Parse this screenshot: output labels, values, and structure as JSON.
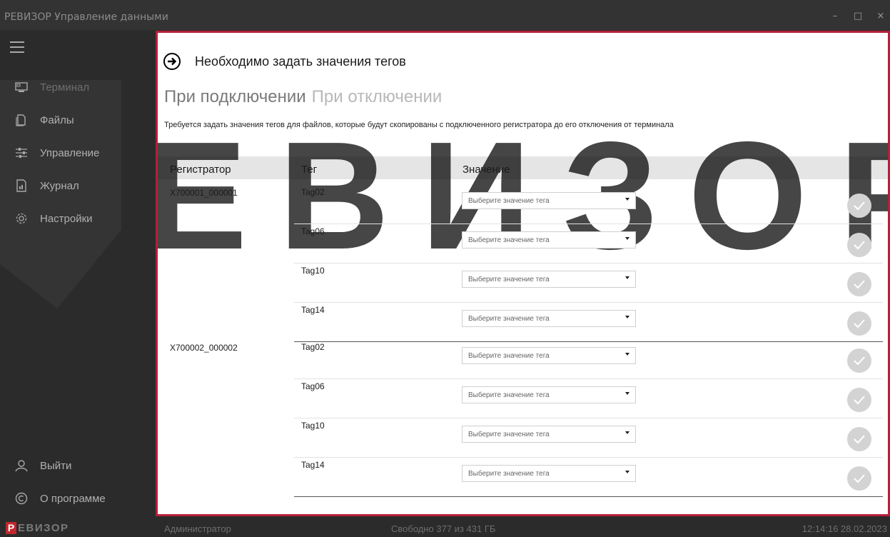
{
  "window": {
    "title": "РЕВИЗОР Управление данными",
    "minimize": "–",
    "maximize": "□",
    "close": "×"
  },
  "sidebar": {
    "items": [
      {
        "label": "Терминал",
        "icon": "terminal-icon"
      },
      {
        "label": "Файлы",
        "icon": "files-icon"
      },
      {
        "label": "Управление",
        "icon": "sliders-icon"
      },
      {
        "label": "Журнал",
        "icon": "journal-icon"
      },
      {
        "label": "Настройки",
        "icon": "gear-icon"
      }
    ],
    "bottom": [
      {
        "label": "Выйти",
        "icon": "user-icon"
      },
      {
        "label": "О программе",
        "icon": "copyright-icon"
      }
    ]
  },
  "statusbar": {
    "logo_letter": "Р",
    "logo_rest": "ЕВИЗОР",
    "user": "Администратор",
    "free_space": "Свободно 377 из 431 ГБ",
    "datetime": "12:14:16 28.02.2023"
  },
  "main": {
    "header_title": "Необходимо задать значения тегов",
    "tabs": [
      {
        "label": "При подключении",
        "active": true
      },
      {
        "label": "При отключении",
        "active": false
      }
    ],
    "description": "Требуется задать значения тегов для файлов, которые будут скопированы с подключенного регистратора до его отключения от терминала",
    "columns": {
      "registrator": "Регистратор",
      "tag": "Тег",
      "value": "Значение"
    },
    "registrators": [
      {
        "id": "X700001_000001",
        "rows": [
          {
            "tag": "Tag02",
            "placeholder": "Выберите значение тега"
          },
          {
            "tag": "Tag06",
            "placeholder": "Выберите значение тега"
          },
          {
            "tag": "Tag10",
            "placeholder": "Выберите значение тега"
          },
          {
            "tag": "Tag14",
            "placeholder": "Выберите значение тега"
          }
        ]
      },
      {
        "id": "X700002_000002",
        "rows": [
          {
            "tag": "Tag02",
            "placeholder": "Выберите значение тега"
          },
          {
            "tag": "Tag06",
            "placeholder": "Выберите значение тега"
          },
          {
            "tag": "Tag10",
            "placeholder": "Выберите значение тега"
          },
          {
            "tag": "Tag14",
            "placeholder": "Выберите значение тега"
          }
        ]
      }
    ]
  },
  "watermark": "ЕВИЗОР",
  "colors": {
    "accent_border": "#b51f3a",
    "logo_red": "#c1272d",
    "sidebar_bg": "#2b2b2b"
  }
}
